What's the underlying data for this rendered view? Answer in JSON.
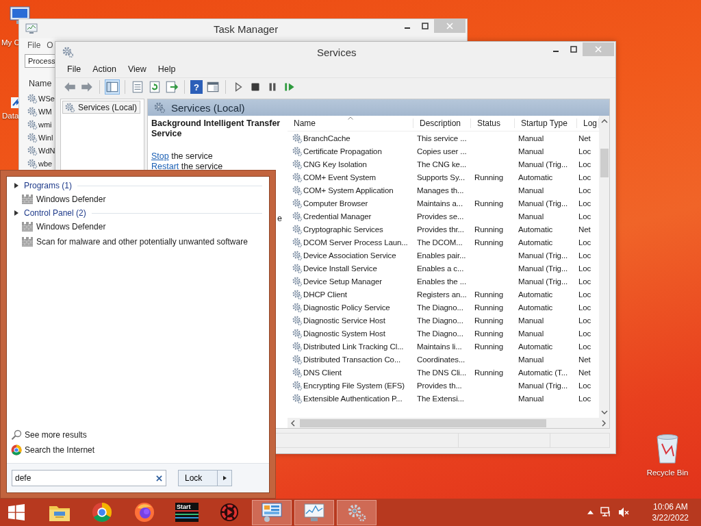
{
  "desktop_icons": [
    {
      "label": "My C",
      "kind": "computer"
    },
    {
      "label": "Data",
      "kind": "shortcut"
    },
    {
      "label": "Recycle Bin",
      "kind": "bin"
    }
  ],
  "task_manager": {
    "title": "Task Manager",
    "menu": [
      "File",
      "O"
    ],
    "tabs": [
      {
        "label": "Process",
        "selected": true
      }
    ],
    "column": "Name",
    "rows": [
      "WSe",
      "WM",
      "wmi",
      "Winl",
      "WdN",
      "wbe"
    ]
  },
  "services_window": {
    "title": "Services",
    "menu": [
      "File",
      "Action",
      "View",
      "Help"
    ],
    "toolbar": [
      [
        {
          "kind": "back",
          "pressed": false
        },
        {
          "kind": "forward",
          "pressed": false
        }
      ],
      [
        {
          "kind": "tree",
          "pressed": true
        }
      ],
      [
        {
          "kind": "properties",
          "pressed": false
        },
        {
          "kind": "refresh",
          "pressed": false
        },
        {
          "kind": "export",
          "pressed": false
        }
      ],
      [
        {
          "kind": "help",
          "pressed": false,
          "glyph": "?"
        },
        {
          "kind": "console",
          "pressed": false
        }
      ],
      [
        {
          "kind": "play",
          "pressed": false
        },
        {
          "kind": "stop",
          "pressed": false
        },
        {
          "kind": "pause",
          "pressed": false
        },
        {
          "kind": "resume",
          "pressed": false
        }
      ]
    ],
    "tree": [
      {
        "label": "Services (Local)",
        "selected": true
      }
    ],
    "panel_title": "Services (Local)",
    "detail": {
      "title": "Background Intelligent Transfer Service",
      "actions": [
        {
          "link": "Stop",
          "rest": "the service"
        },
        {
          "link": "Restart",
          "rest": "the service"
        }
      ],
      "fragment": "e"
    },
    "columns": [
      "Name",
      "Description",
      "Status",
      "Startup Type",
      "Log"
    ],
    "rows": [
      {
        "name": "BranchCache",
        "description": "This service ...",
        "startup_type": "Manual",
        "log": "Net"
      },
      {
        "name": "Certificate Propagation",
        "description": "Copies user ...",
        "startup_type": "Manual",
        "log": "Loc"
      },
      {
        "name": "CNG Key Isolation",
        "description": "The CNG ke...",
        "startup_type": "Manual (Trig...",
        "log": "Loc"
      },
      {
        "name": "COM+ Event System",
        "description": "Supports Sy...",
        "status": "Running",
        "startup_type": "Automatic",
        "log": "Loc"
      },
      {
        "name": "COM+ System Application",
        "description": "Manages th...",
        "startup_type": "Manual",
        "log": "Loc"
      },
      {
        "name": "Computer Browser",
        "description": "Maintains a...",
        "status": "Running",
        "startup_type": "Manual (Trig...",
        "log": "Loc"
      },
      {
        "name": "Credential Manager",
        "description": "Provides se...",
        "startup_type": "Manual",
        "log": "Loc"
      },
      {
        "name": "Cryptographic Services",
        "description": "Provides thr...",
        "status": "Running",
        "startup_type": "Automatic",
        "log": "Net"
      },
      {
        "name": "DCOM Server Process Laun...",
        "description": "The DCOM...",
        "status": "Running",
        "startup_type": "Automatic",
        "log": "Loc"
      },
      {
        "name": "Device Association Service",
        "description": "Enables pair...",
        "startup_type": "Manual (Trig...",
        "log": "Loc"
      },
      {
        "name": "Device Install Service",
        "description": "Enables a c...",
        "startup_type": "Manual (Trig...",
        "log": "Loc"
      },
      {
        "name": "Device Setup Manager",
        "description": "Enables the ...",
        "startup_type": "Manual (Trig...",
        "log": "Loc"
      },
      {
        "name": "DHCP Client",
        "description": "Registers an...",
        "status": "Running",
        "startup_type": "Automatic",
        "log": "Loc"
      },
      {
        "name": "Diagnostic Policy Service",
        "description": "The Diagno...",
        "status": "Running",
        "startup_type": "Automatic",
        "log": "Loc"
      },
      {
        "name": "Diagnostic Service Host",
        "description": "The Diagno...",
        "status": "Running",
        "startup_type": "Manual",
        "log": "Loc"
      },
      {
        "name": "Diagnostic System Host",
        "description": "The Diagno...",
        "status": "Running",
        "startup_type": "Manual",
        "log": "Loc"
      },
      {
        "name": "Distributed Link Tracking Cl...",
        "description": "Maintains li...",
        "status": "Running",
        "startup_type": "Automatic",
        "log": "Loc"
      },
      {
        "name": "Distributed Transaction Co...",
        "description": "Coordinates...",
        "startup_type": "Manual",
        "log": "Net"
      },
      {
        "name": "DNS Client",
        "description": "The DNS Cli...",
        "status": "Running",
        "startup_type": "Automatic (T...",
        "log": "Net"
      },
      {
        "name": "Encrypting File System (EFS)",
        "description": "Provides th...",
        "startup_type": "Manual (Trig...",
        "log": "Loc"
      },
      {
        "name": "Extensible Authentication P...",
        "description": "The Extensi...",
        "startup_type": "Manual",
        "log": "Loc"
      }
    ]
  },
  "search_menu": {
    "groups": [
      {
        "label": "Programs (1)",
        "items": [
          "Windows Defender"
        ]
      },
      {
        "label": "Control Panel (2)",
        "items": [
          "Windows Defender",
          "Scan for malware and other potentially unwanted software"
        ]
      }
    ],
    "links": [
      {
        "label": "See more results",
        "kind": "search"
      },
      {
        "label": "Search the Internet",
        "kind": "web"
      }
    ],
    "query": "defe",
    "power_button": "Lock"
  },
  "taskbar": {
    "apps": [
      {
        "kind": "windows",
        "running": false
      },
      {
        "kind": "folder",
        "running": false
      },
      {
        "kind": "chrome",
        "running": false
      },
      {
        "kind": "firefox",
        "running": false
      },
      {
        "kind": "start-app",
        "running": false,
        "label": "Start"
      },
      {
        "kind": "red-app",
        "running": false
      },
      {
        "kind": "control-panel",
        "running": true
      },
      {
        "kind": "task-manager",
        "running": true
      },
      {
        "kind": "services",
        "running": true
      }
    ],
    "time": "10:06 AM",
    "date": "3/22/2022"
  }
}
